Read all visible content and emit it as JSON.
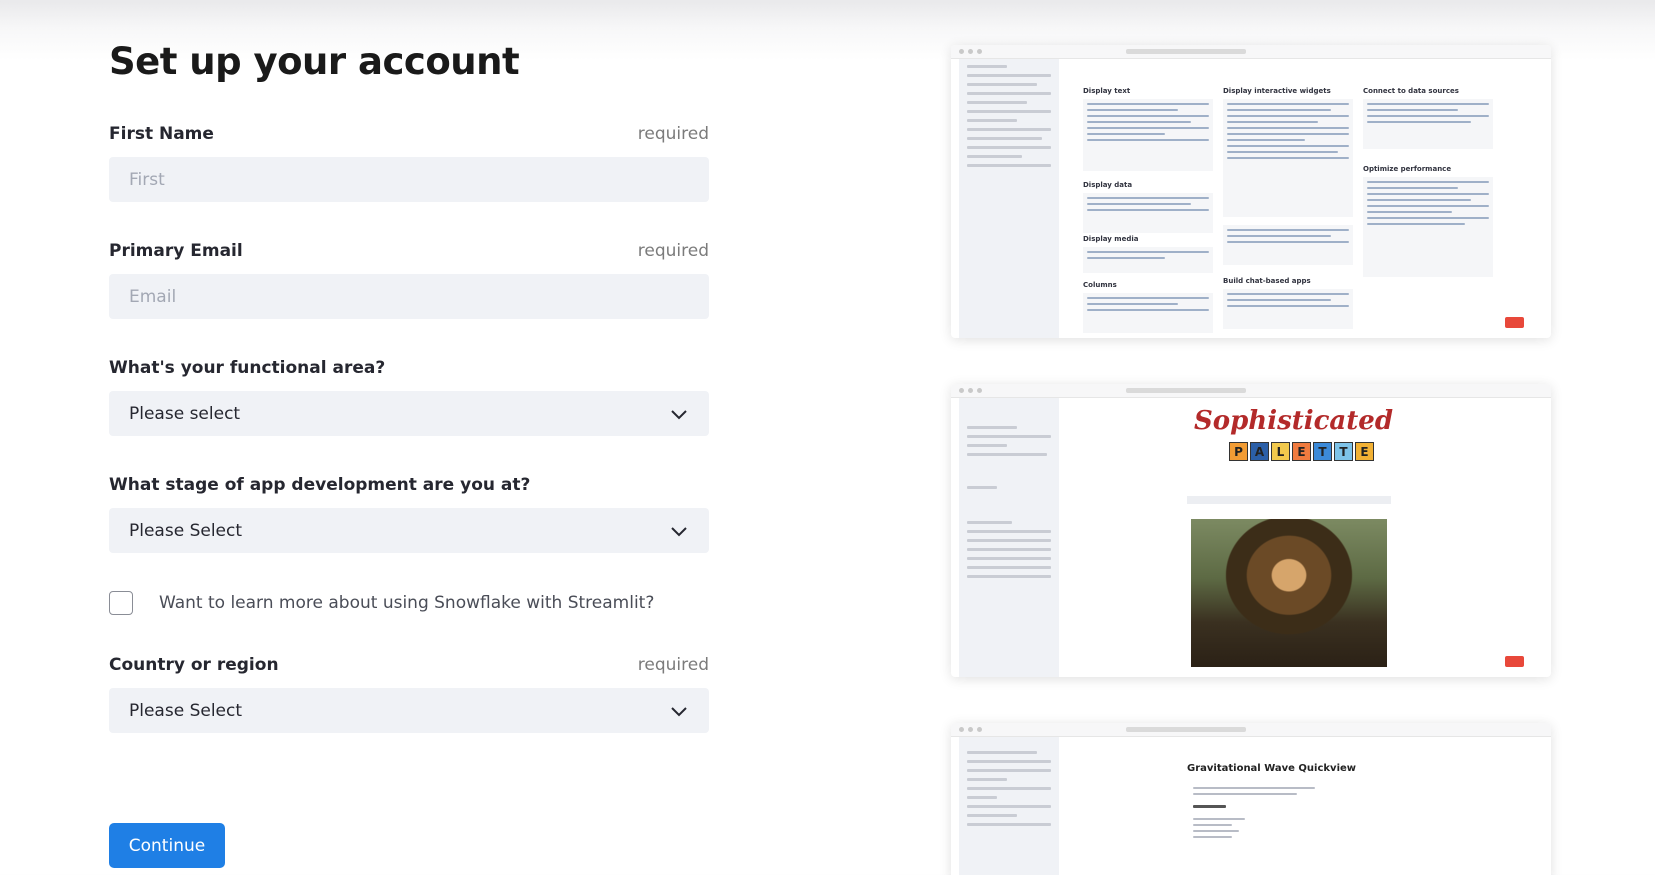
{
  "form": {
    "title": "Set up your account",
    "required_text": "required",
    "first_name": {
      "label": "First Name",
      "placeholder": "First",
      "value": ""
    },
    "primary_email": {
      "label": "Primary Email",
      "placeholder": "Email",
      "value": ""
    },
    "functional_area": {
      "label": "What's your functional area?",
      "selected": "Please select"
    },
    "app_stage": {
      "label": "What stage of app development are you at?",
      "selected": "Please Select"
    },
    "snowflake_checkbox": {
      "label": "Want to learn more about using Snowflake with Streamlit?",
      "checked": false
    },
    "country": {
      "label": "Country or region",
      "selected": "Please Select"
    },
    "continue_label": "Continue"
  },
  "previews": [
    {
      "name": "cheat-sheet",
      "headings": [
        "Display text",
        "Display interactive widgets",
        "Connect to data sources",
        "Display data",
        "Display media",
        "Columns",
        "Build chat-based apps",
        "Optimize performance"
      ]
    },
    {
      "name": "sophisticated-palette",
      "title": "Sophisticated",
      "tiles": [
        "P",
        "A",
        "L",
        "E",
        "T",
        "T",
        "E"
      ],
      "tile_colors": [
        "#f29c34",
        "#2b5fa8",
        "#f2c94c",
        "#f07b3f",
        "#3c8ad8",
        "#7ec3e8",
        "#f2b134"
      ]
    },
    {
      "name": "gravitational-wave",
      "title": "Gravitational Wave Quickview"
    }
  ],
  "colors": {
    "accent": "#1f7fe5",
    "field_bg": "#f0f2f6",
    "text": "#262730"
  },
  "icons": {
    "select_arrow": "chevron-down-icon"
  }
}
